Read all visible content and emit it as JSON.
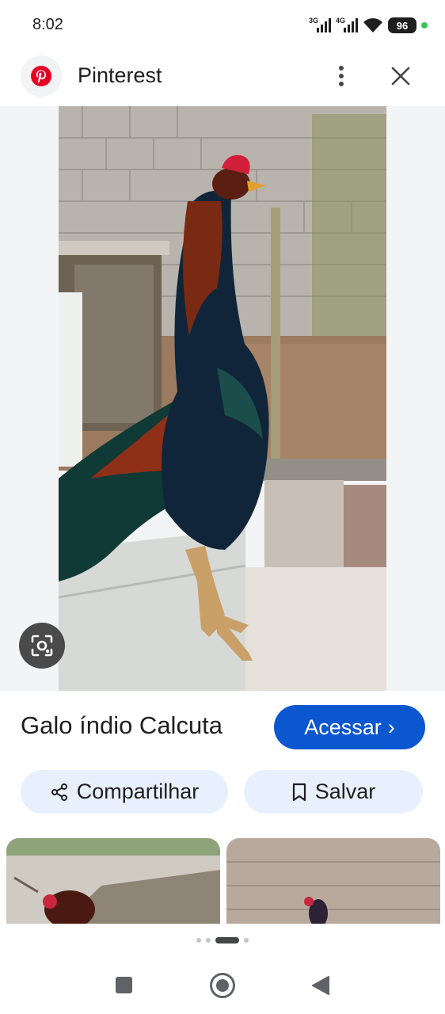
{
  "status_bar": {
    "time": "8:02",
    "network_1": "3G",
    "network_2": "4G",
    "battery": "96",
    "icons": [
      "signal-icon",
      "signal-icon",
      "wifi-icon",
      "battery-icon",
      "privacy-dot-icon"
    ]
  },
  "header": {
    "app_name": "Pinterest",
    "icons": [
      "pinterest-logo-icon",
      "more-vert-icon",
      "close-icon"
    ]
  },
  "image": {
    "title": "Galo índio Calcuta",
    "visit_label": "Acessar",
    "visit_chevron": "›"
  },
  "actions": {
    "share_label": "Compartilhar",
    "save_label": "Salvar",
    "icons": [
      "share-icon",
      "bookmark-icon",
      "lens-icon"
    ]
  },
  "pager": {
    "count": 4,
    "active": 2
  },
  "colors": {
    "accent": "#0b57d0",
    "chip_bg": "#e8f0fe",
    "pinterest_red": "#e60023",
    "image_bg": "#f2f4f5"
  }
}
